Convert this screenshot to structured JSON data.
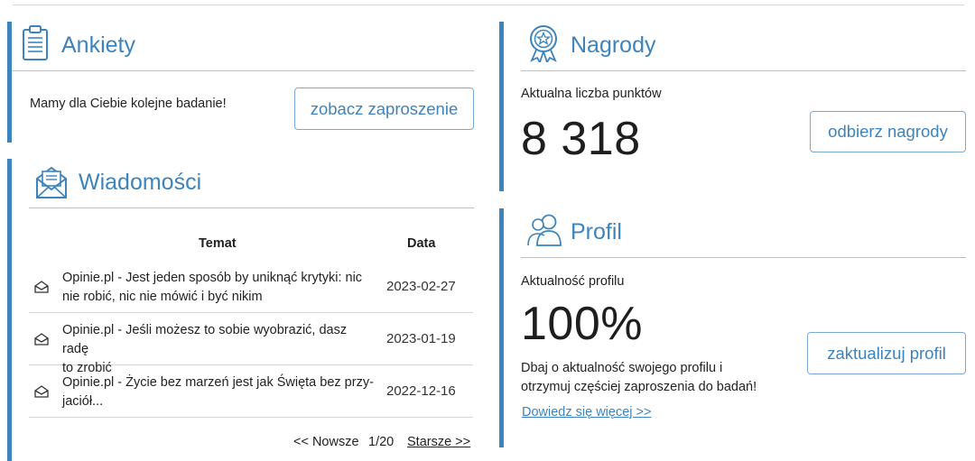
{
  "surveys": {
    "title": "Ankiety",
    "message": "Mamy dla Ciebie kolejne badanie!",
    "button": "zobacz zaproszenie"
  },
  "messages": {
    "title": "Wiadomości",
    "col_subject": "Temat",
    "col_date": "Data",
    "rows": [
      {
        "subject_line1": "Opinie.pl - Jest jeden sposób by uniknąć krytyki: nic",
        "subject_line2": "nie robić, nic nie mówić i być nikim",
        "date": "2023-02-27"
      },
      {
        "subject_line1": "Opinie.pl - Jeśli możesz to sobie wyobrazić, dasz radę",
        "subject_line2": "to zrobić",
        "date": "2023-01-19"
      },
      {
        "subject_line1": "Opinie.pl - Życie bez marzeń jest jak Święta bez przy-",
        "subject_line2": "jaciół...",
        "date": "2022-12-16"
      }
    ],
    "pager": {
      "newer": "<< Nowsze",
      "page": "1/20",
      "older": "Starsze >>"
    }
  },
  "rewards": {
    "title": "Nagrody",
    "points_label": "Aktualna liczba punktów",
    "points_value": "8 318",
    "button": "odbierz nagrody"
  },
  "profile": {
    "title": "Profil",
    "status_label": "Aktualność profilu",
    "completion_value": "100%",
    "hint_line1": "Dbaj o aktualność swojego profilu i",
    "hint_line2": "otrzymuj częściej zaproszenia do badań!",
    "more_link": "Dowiedz się więcej >>",
    "button": "zaktualizuj profil"
  },
  "colors": {
    "accent": "#3d84bd",
    "divider": "#bfbfbf",
    "text": "#222222"
  },
  "icons": [
    "clipboard-icon",
    "envelope-icon",
    "award-ribbon-icon",
    "users-icon",
    "envelope-open-icon"
  ]
}
